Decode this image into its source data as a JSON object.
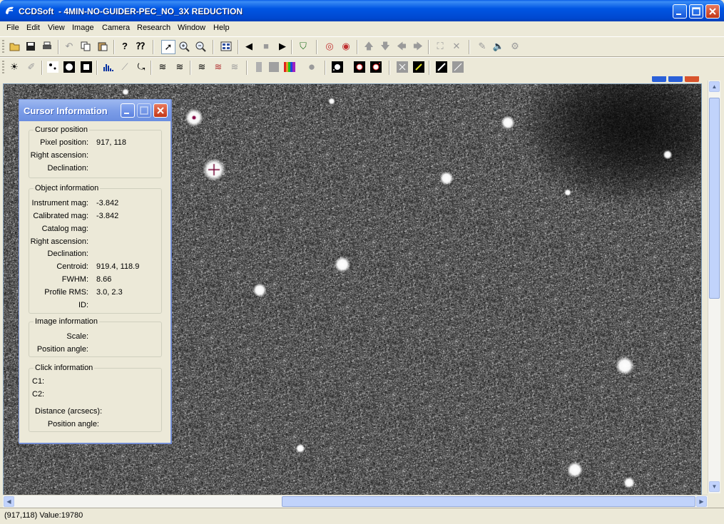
{
  "window": {
    "title": "CCDSoft  - 4MIN-NO-GUIDER-PEC_NO_3X REDUCTION",
    "controls": [
      "minimize",
      "maximize",
      "close"
    ]
  },
  "menu": [
    "File",
    "Edit",
    "View",
    "Image",
    "Camera",
    "Research",
    "Window",
    "Help"
  ],
  "toolbar1": [
    "open-icon",
    "save-icon",
    "print-icon",
    "undo-icon",
    "copy-icon",
    "paste-icon",
    "help-icon",
    "context-help-icon",
    "pointer-icon",
    "zoom-in-icon",
    "zoom-out-icon",
    "tile-icon",
    "previous-icon",
    "stop-icon",
    "next-icon",
    "green-cup-icon",
    "target-icon",
    "targets-icon",
    "arrow-up-icon",
    "arrow-down-icon",
    "arrow-left-icon",
    "arrow-right-icon",
    "fit-icon",
    "collapse-icon",
    "pen-icon",
    "speaker-icon",
    "camera-icon"
  ],
  "toolbar2": [
    "brightness-icon",
    "eraser-icon",
    "star-small-icon",
    "star-medium-icon",
    "star-large-icon",
    "histogram-icon",
    "curve-icon",
    "transform-icon",
    "stack1-icon",
    "stack2-icon",
    "stack3-icon",
    "stack4-icon",
    "stack5-icon",
    "gray-icon",
    "square-icon",
    "color-bars-icon",
    "circle-icon",
    "field1-icon",
    "field2-icon",
    "field3-icon",
    "field4-icon",
    "field5-icon",
    "field6-icon",
    "field7-icon"
  ],
  "cursor_info": {
    "title": "Cursor Information",
    "cursor_position": {
      "legend": "Cursor position",
      "pixel_label": "Pixel position:",
      "pixel_value": "917, 118",
      "ra_label": "Right ascension:",
      "ra_value": "",
      "dec_label": "Declination:",
      "dec_value": ""
    },
    "object_information": {
      "legend": "Object information",
      "instrument_label": "Instrument mag:",
      "instrument_value": "-3.842",
      "calibrated_label": "Calibrated mag:",
      "calibrated_value": "-3.842",
      "catalog_label": "Catalog mag:",
      "catalog_value": "",
      "ra_label": "Right ascension:",
      "ra_value": "",
      "dec_label": "Declination:",
      "dec_value": "",
      "centroid_label": "Centroid:",
      "centroid_value": "919.4, 118.9",
      "fwhm_label": "FWHM:",
      "fwhm_value": "8.66",
      "profile_label": "Profile RMS:",
      "profile_value": "3.0, 2.3",
      "id_label": "ID:",
      "id_value": ""
    },
    "image_information": {
      "legend": "Image information",
      "scale_label": "Scale:",
      "scale_value": "",
      "angle_label": "Position angle:",
      "angle_value": ""
    },
    "click_information": {
      "legend": "Click information",
      "c1_label": "C1:",
      "c2_label": "C2:",
      "distance_label": "Distance (arcsecs):",
      "distance_value": "",
      "angle_label": "Position angle:",
      "angle_value": ""
    }
  },
  "status": "(917,118) Value:19780",
  "colors": {
    "titlebar": "#0056e3",
    "chrome": "#ece9d8",
    "image_bg": "#1c1c1c",
    "palette_title": "#7d9ee8"
  }
}
